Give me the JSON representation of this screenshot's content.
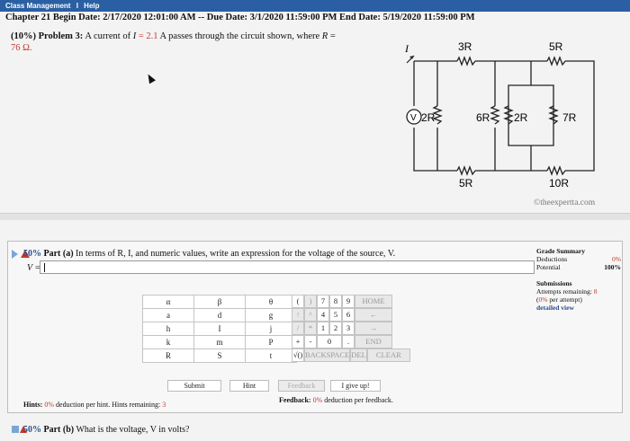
{
  "menubar": {
    "class_management": "Class Management",
    "separator": "I",
    "help": "Help"
  },
  "header": "Chapter 21 Begin Date: 2/17/2020 12:01:00 AM -- Due Date: 3/1/2020 11:59:00 PM End Date: 5/19/2020 11:59:00 PM",
  "problem": {
    "weight": "(10%)",
    "title": "Problem 3:",
    "text_before": "A current of ",
    "var_i": "I",
    "eq1": " = 2.1",
    "text_mid": " A passes through the circuit shown, where ",
    "var_r": "R",
    "eq2": " =",
    "value_r": "76 Ω."
  },
  "circuit": {
    "current_label": "I",
    "voltmeter_label": "V",
    "labels": [
      "3R",
      "5R",
      "2R",
      "6R",
      "2R",
      "7R",
      "5R",
      "10R"
    ]
  },
  "credit": "©theexpertta.com",
  "partA": {
    "pct": "50%",
    "label": "Part (a)",
    "question": "In terms of R, I, and numeric values, write an expression for the voltage of the source, V."
  },
  "answer": {
    "label": "V ="
  },
  "grade": {
    "title": "Grade Summary",
    "deductions_label": "Deductions",
    "deductions_value": "0%",
    "potential_label": "Potential",
    "potential_value": "100%",
    "submissions_label": "Submissions",
    "attempts_text": "Attempts remaining:",
    "attempts_value": "8",
    "per_attempt_pct": "0%",
    "per_attempt_text": "per attempt)",
    "detailed_view": "detailed view"
  },
  "variables": [
    [
      "α",
      "β",
      "θ"
    ],
    [
      "a",
      "d",
      "g"
    ],
    [
      "h",
      "I",
      "j"
    ],
    [
      "k",
      "m",
      "P"
    ],
    [
      "R",
      "S",
      "t"
    ]
  ],
  "keypad": {
    "row1": [
      "(",
      ")",
      "7",
      "8",
      "9",
      "HOME"
    ],
    "row2": [
      "↑",
      "^",
      "4",
      "5",
      "6",
      "←"
    ],
    "row3": [
      "/",
      "*",
      "1",
      "2",
      "3",
      "→"
    ],
    "row4": [
      "+",
      "-",
      "0",
      ".",
      "END"
    ],
    "row5": [
      "√()",
      "BACKSPACE",
      "DEL",
      "CLEAR"
    ]
  },
  "buttons": {
    "submit": "Submit",
    "hint": "Hint",
    "feedback": "Feedback",
    "give_up": "I give up!"
  },
  "hints": {
    "label": "Hints:",
    "pct": "0%",
    "text": "deduction per hint. Hints remaining:",
    "remaining": "3"
  },
  "feedback": {
    "label": "Feedback:",
    "pct": "0%",
    "text": "deduction per feedback."
  },
  "partB": {
    "pct": "50%",
    "label": "Part (b)",
    "question": "What is the voltage, V in volts?"
  }
}
